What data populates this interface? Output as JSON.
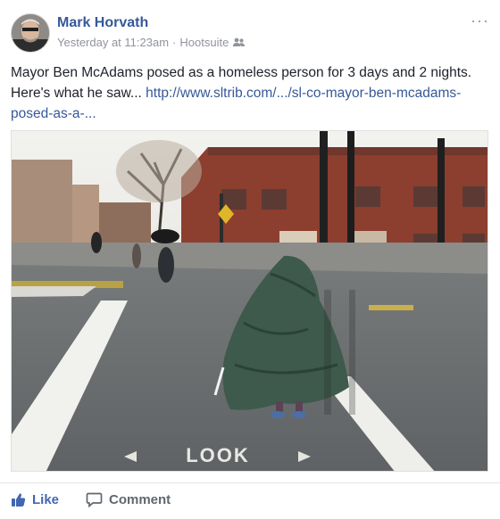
{
  "post": {
    "author": "Mark Horvath",
    "timestamp": "Yesterday at 11:23am",
    "separator": "·",
    "source": "Hootsuite",
    "privacy_icon": "friends-icon",
    "more_label": "···",
    "text_line": "Mayor Ben McAdams posed as a homeless person for 3 days and 2 nights. Here's what he saw...",
    "link": "http://www.sltrib.com/.../sl-co-mayor-ben-mcadams-posed-as-a-...",
    "photo_caption_text": "LOOK"
  },
  "actions": {
    "like_label": "Like",
    "comment_label": "Comment"
  },
  "colors": {
    "author": "#365899",
    "link": "#365899",
    "like": "#4267b2",
    "muted": "#90949c"
  }
}
